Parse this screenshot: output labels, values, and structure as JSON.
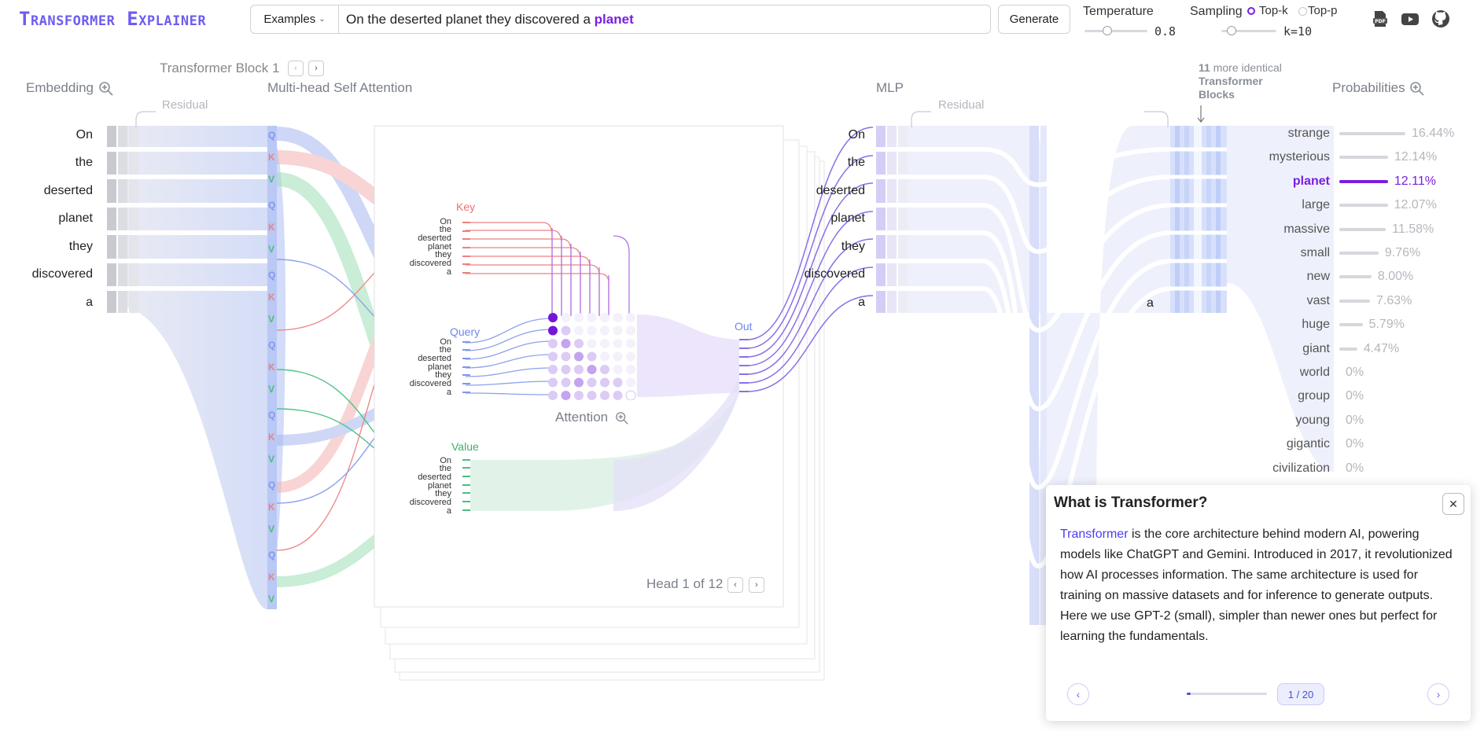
{
  "header": {
    "logo": "Transformer Explainer",
    "examples_label": "Examples",
    "prompt_text": "On the deserted planet they discovered a",
    "predicted_token": "planet",
    "generate_label": "Generate",
    "temperature_label": "Temperature",
    "temperature_value": "0.8",
    "sampling_label": "Sampling",
    "topk_label": "Top-k",
    "topp_label": "Top-p",
    "k_value": "k=10"
  },
  "sections": {
    "block_title": "Transformer Block 1",
    "embedding": "Embedding",
    "mhsa": "Multi-head Self Attention",
    "residual": "Residual",
    "mlp": "MLP",
    "more_count": "11",
    "more_text_1": "more identical",
    "more_text_2": "Transformer",
    "more_text_3": "Blocks",
    "probabilities": "Probabilities",
    "key": "Key",
    "query": "Query",
    "value": "Value",
    "out": "Out",
    "attention": "Attention",
    "head_label": "Head 1 of 12",
    "qkv_q": "Q",
    "qkv_k": "K",
    "qkv_v": "V"
  },
  "tokens": [
    "On",
    "the",
    "deserted",
    "planet",
    "they",
    "discovered",
    "a"
  ],
  "probabilities": [
    {
      "word": "strange",
      "pct": "16.44%",
      "value": 16.44
    },
    {
      "word": "mysterious",
      "pct": "12.14%",
      "value": 12.14
    },
    {
      "word": "planet",
      "pct": "12.11%",
      "value": 12.11,
      "selected": true
    },
    {
      "word": "large",
      "pct": "12.07%",
      "value": 12.07
    },
    {
      "word": "massive",
      "pct": "11.58%",
      "value": 11.58
    },
    {
      "word": "small",
      "pct": "9.76%",
      "value": 9.76
    },
    {
      "word": "new",
      "pct": "8.00%",
      "value": 8.0
    },
    {
      "word": "vast",
      "pct": "7.63%",
      "value": 7.63
    },
    {
      "word": "huge",
      "pct": "5.79%",
      "value": 5.79
    },
    {
      "word": "giant",
      "pct": "4.47%",
      "value": 4.47
    },
    {
      "word": "world",
      "pct": "0%",
      "value": 0
    },
    {
      "word": "group",
      "pct": "0%",
      "value": 0
    },
    {
      "word": "young",
      "pct": "0%",
      "value": 0
    },
    {
      "word": "gigantic",
      "pct": "0%",
      "value": 0
    },
    {
      "word": "civilization",
      "pct": "0%",
      "value": 0
    }
  ],
  "panel": {
    "title": "What is Transformer?",
    "highlight": "Transformer",
    "body": " is the core architecture behind modern AI, powering models like ChatGPT and Gemini. Introduced in 2017, it revolutionized how AI processes information. The same architecture is used for training on massive datasets and for inference to generate outputs. Here we use GPT-2 (small), simpler than newer ones but perfect for learning the fundamentals.",
    "page": "1 / 20",
    "progress": 0.05
  },
  "icons": {
    "pdf": "pdf-icon",
    "youtube": "youtube-icon",
    "github": "github-icon",
    "zoom": "zoom-in-icon"
  },
  "colors": {
    "accent": "#6d5cf0",
    "predicted": "#7a1ee0",
    "query": "#7f97f0",
    "key": "#ef7f7f",
    "value": "#4cbf7a"
  }
}
